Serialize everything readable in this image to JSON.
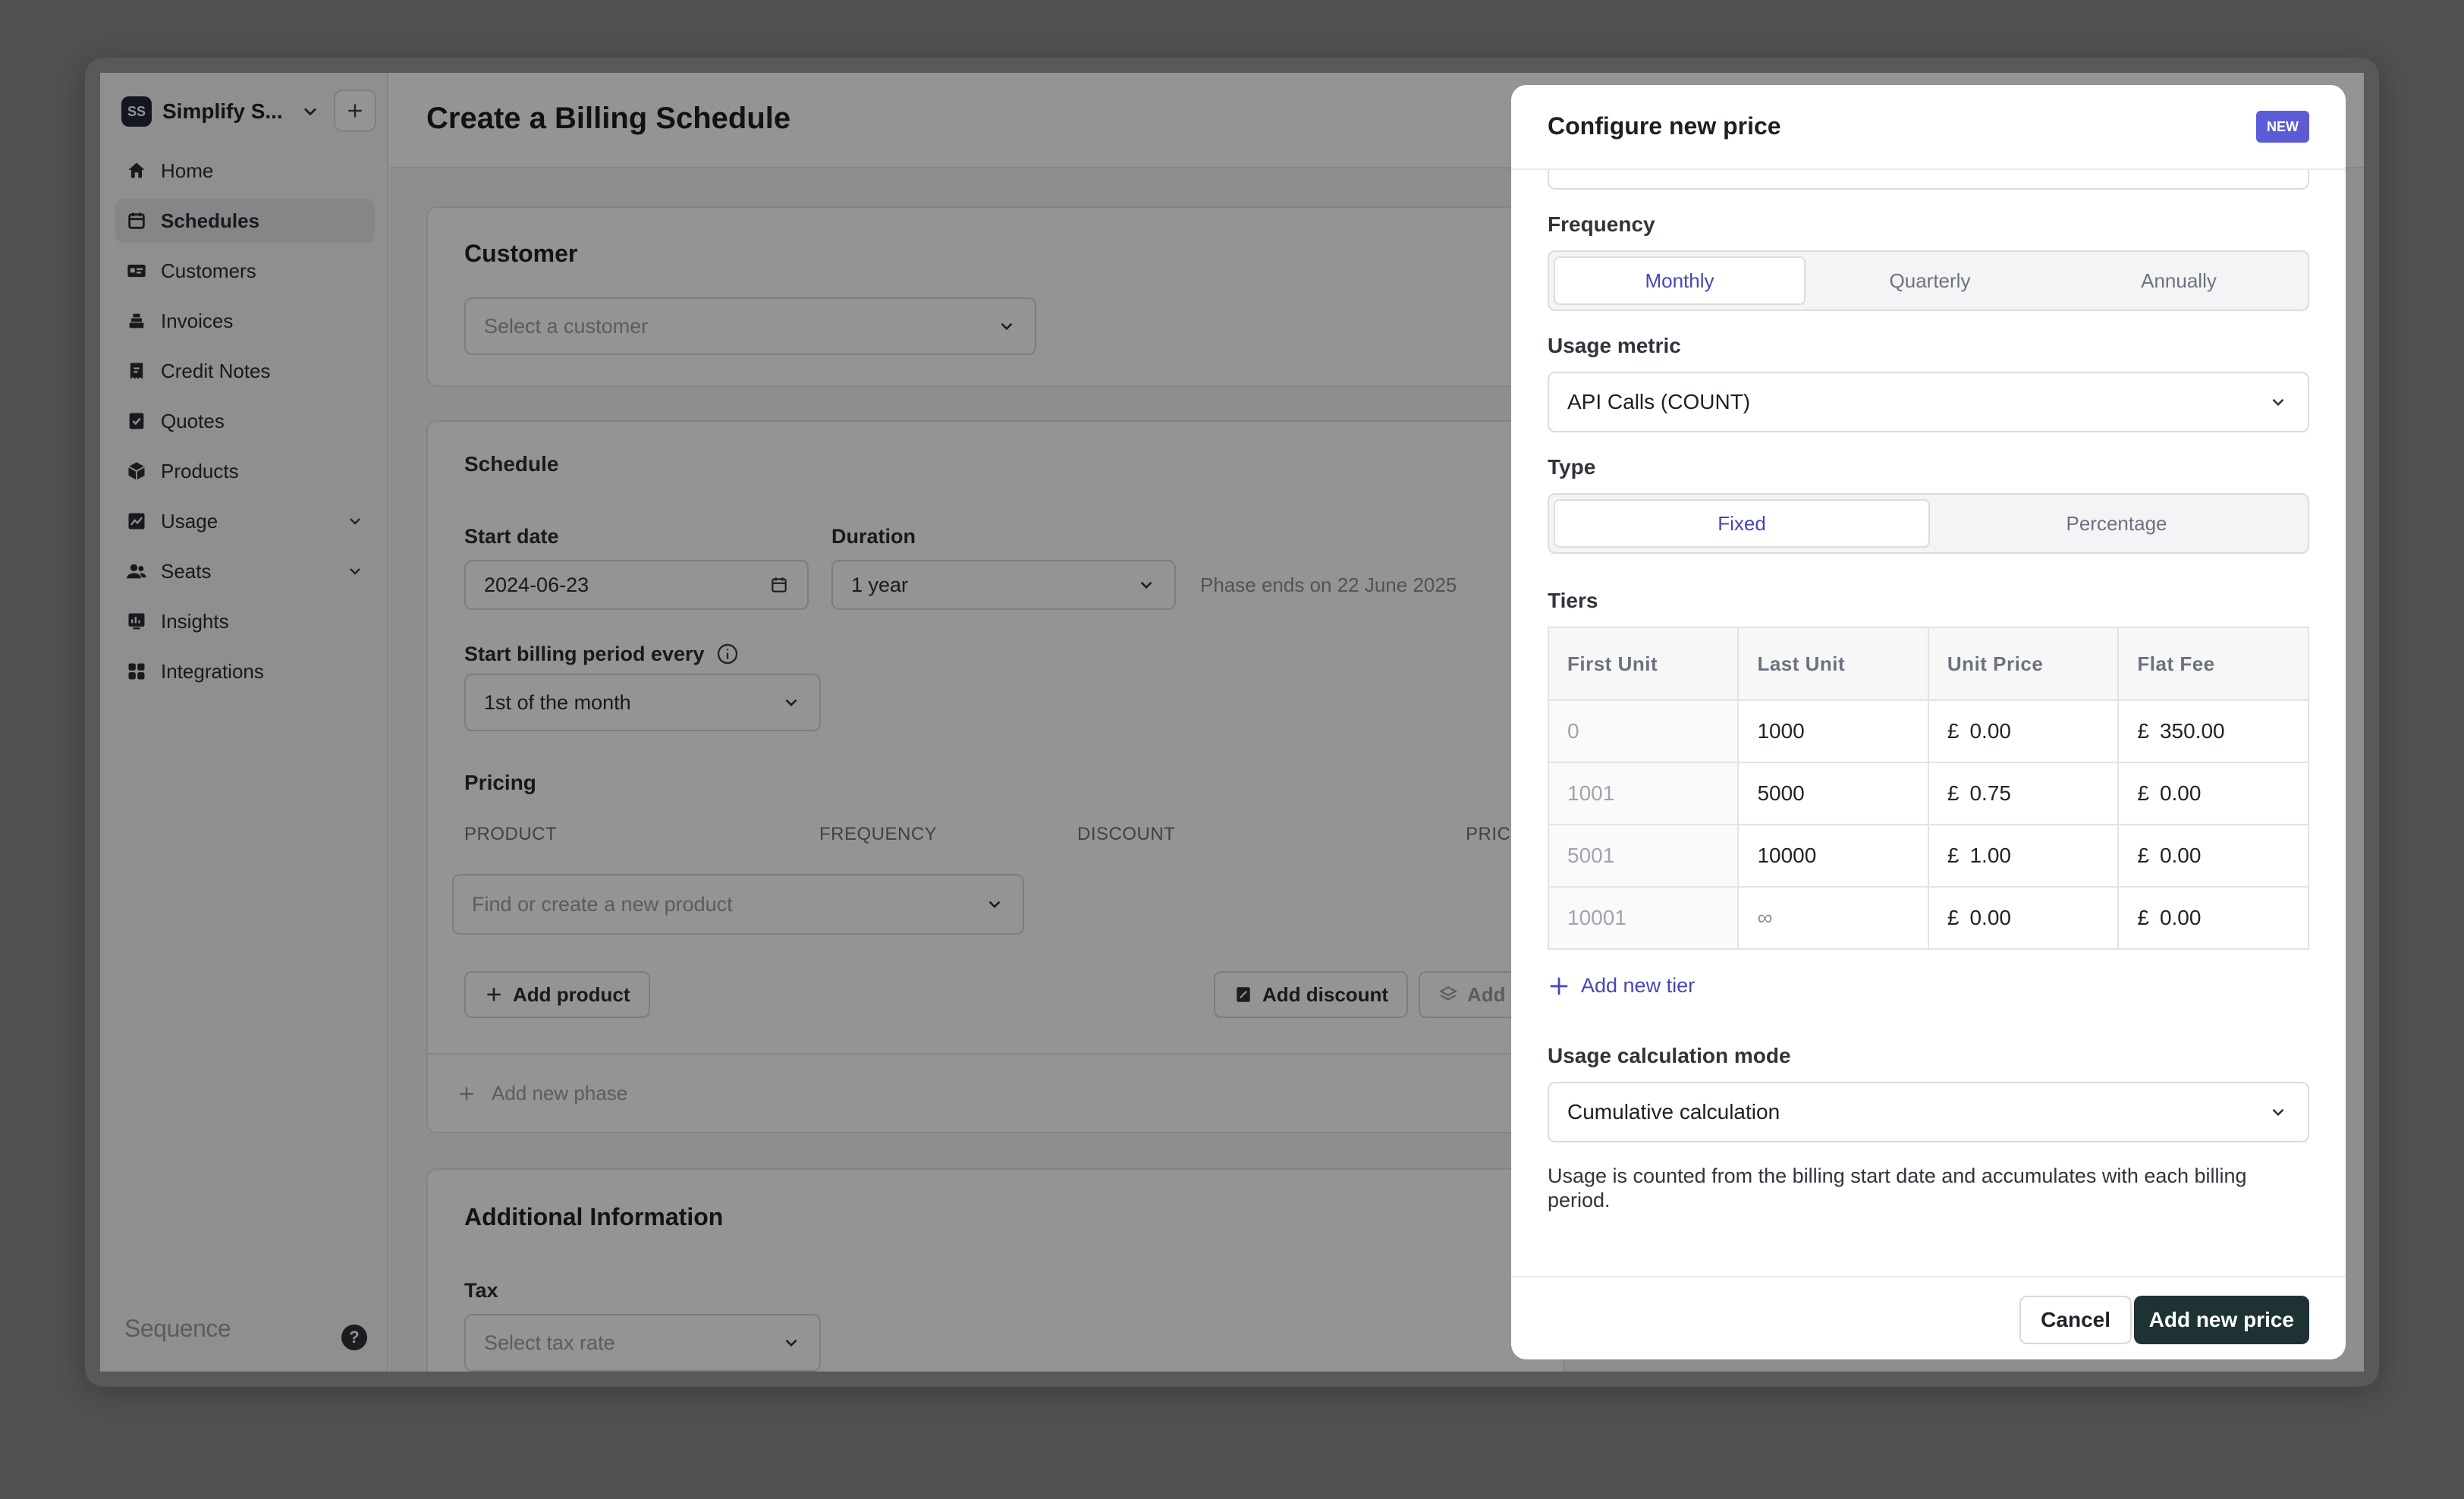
{
  "sidebar": {
    "workspace_initials": "SS",
    "workspace_name": "Simplify S...",
    "items": [
      {
        "label": "Home"
      },
      {
        "label": "Schedules"
      },
      {
        "label": "Customers"
      },
      {
        "label": "Invoices"
      },
      {
        "label": "Credit Notes"
      },
      {
        "label": "Quotes"
      },
      {
        "label": "Products"
      },
      {
        "label": "Usage"
      },
      {
        "label": "Seats"
      },
      {
        "label": "Insights"
      },
      {
        "label": "Integrations"
      }
    ],
    "brand": "Sequence",
    "help": "?"
  },
  "page": {
    "title": "Create a Billing Schedule",
    "customer": {
      "heading": "Customer",
      "placeholder": "Select a customer"
    },
    "schedule": {
      "heading": "Schedule",
      "start_date_label": "Start date",
      "start_date_value": "2024-06-23",
      "duration_label": "Duration",
      "duration_value": "1 year",
      "phase_note": "Phase ends on 22 June 2025",
      "billing_period_label": "Start billing period every",
      "billing_period_value": "1st of the month",
      "pricing_label": "Pricing",
      "columns": [
        "PRODUCT",
        "FREQUENCY",
        "DISCOUNT",
        "PRIC"
      ],
      "product_placeholder": "Find or create a new product",
      "add_product": "Add product",
      "add_discount": "Add discount",
      "add_more": "Add m",
      "add_phase": "Add new phase"
    },
    "additional": {
      "heading": "Additional Information",
      "tax_label": "Tax",
      "tax_placeholder": "Select tax rate"
    }
  },
  "modal": {
    "title": "Configure new price",
    "badge": "NEW",
    "frequency_label": "Frequency",
    "frequency_options": [
      "Monthly",
      "Quarterly",
      "Annually"
    ],
    "frequency_selected": "Monthly",
    "usage_metric_label": "Usage metric",
    "usage_metric_value": "API Calls (COUNT)",
    "type_label": "Type",
    "type_options": [
      "Fixed",
      "Percentage"
    ],
    "type_selected": "Fixed",
    "tiers_label": "Tiers",
    "tier_headers": [
      "First Unit",
      "Last Unit",
      "Unit Price",
      "Flat Fee"
    ],
    "currency_symbol": "£",
    "tiers": [
      {
        "first": "0",
        "last": "1000",
        "unit_price": "0.00",
        "flat_fee": "350.00"
      },
      {
        "first": "1001",
        "last": "5000",
        "unit_price": "0.75",
        "flat_fee": "0.00"
      },
      {
        "first": "5001",
        "last": "10000",
        "unit_price": "1.00",
        "flat_fee": "0.00"
      },
      {
        "first": "10001",
        "last": "∞",
        "unit_price": "0.00",
        "flat_fee": "0.00"
      }
    ],
    "add_tier": "Add new tier",
    "calc_mode_label": "Usage calculation mode",
    "calc_mode_value": "Cumulative calculation",
    "calc_mode_hint": "Usage is counted from the billing start date and accumulates with each billing period.",
    "cancel": "Cancel",
    "submit": "Add new price"
  },
  "colors": {
    "accent": "#4646b8",
    "primary_button": "#1e3234",
    "badge": "#5b5bd6"
  }
}
